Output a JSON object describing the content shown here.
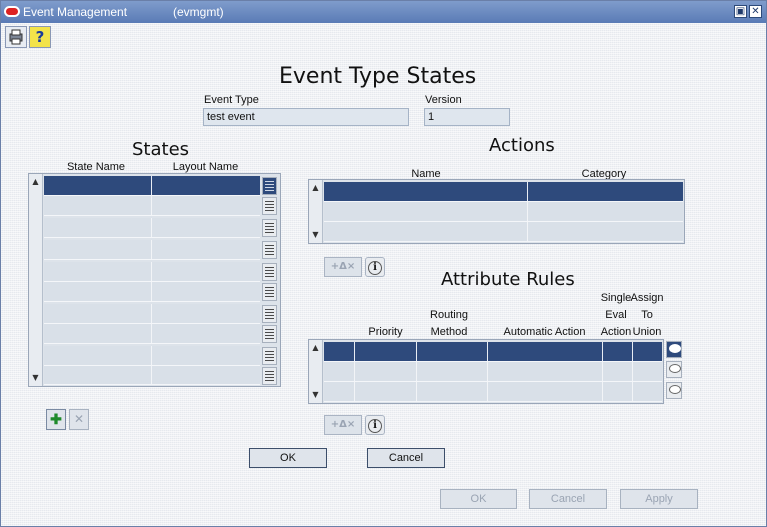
{
  "window": {
    "title": "Event Management",
    "subtitle": "(evmgmt)",
    "minimize_glyph": "▣",
    "close_glyph": "✕"
  },
  "toolbar": {
    "print_icon": "printer-icon",
    "help_glyph": "?"
  },
  "page_title": "Event Type States",
  "event_type": {
    "label": "Event Type",
    "value": "test event"
  },
  "version": {
    "label": "Version",
    "value": "1"
  },
  "states": {
    "heading": "States",
    "columns": [
      "State Name",
      "Layout Name"
    ],
    "add_glyph": "✚",
    "delete_glyph": "✕"
  },
  "actions": {
    "heading": "Actions",
    "columns": [
      "Name",
      "Category"
    ],
    "tb_label": "+Δ×"
  },
  "attribute_rules": {
    "heading": "Attribute Rules",
    "col_priority": "Priority",
    "col_routing_line1": "Routing",
    "col_routing_line2": "Method",
    "col_auto_action": "Automatic Action",
    "col_single_line1": "Single",
    "col_single_line2": "Eval",
    "col_single_line3": "Action",
    "col_assign_line1": "Assign",
    "col_assign_line2": "To",
    "col_assign_line3": "Union",
    "tb_label": "+Δ×"
  },
  "info_glyph": "i",
  "dialog_buttons": {
    "ok": "OK",
    "cancel": "Cancel"
  },
  "footer_buttons": {
    "ok": "OK",
    "cancel": "Cancel",
    "apply": "Apply"
  },
  "colors": {
    "selected_row": "#2e4a7c",
    "titlebar": "#5a7bb6"
  }
}
